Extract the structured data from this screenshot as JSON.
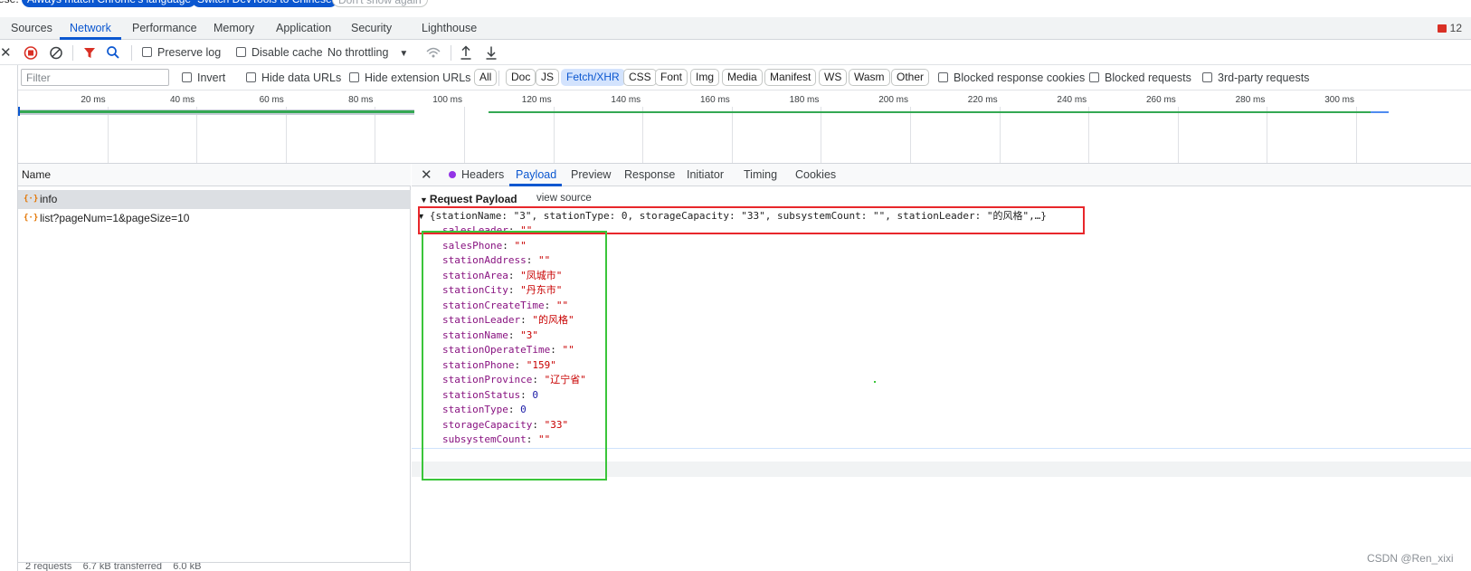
{
  "banner": {
    "prefix": "ese:",
    "buttons": [
      "Always match Chrome's language",
      "Switch DevTools to Chinese",
      "Don't show again"
    ]
  },
  "main_tabs": [
    "Sources",
    "Network",
    "Performance",
    "Memory",
    "Application",
    "Security",
    "Lighthouse"
  ],
  "active_main_tab": "Network",
  "issues_count": "12",
  "toolbar": {
    "preserve_log": "Preserve log",
    "disable_cache": "Disable cache",
    "throttling": "No throttling"
  },
  "filter": {
    "placeholder": "Filter",
    "invert": "Invert",
    "hide_data_urls": "Hide data URLs",
    "hide_extension_urls": "Hide extension URLs",
    "types": [
      "All",
      "Doc",
      "JS",
      "Fetch/XHR",
      "CSS",
      "Font",
      "Img",
      "Media",
      "Manifest",
      "WS",
      "Wasm",
      "Other"
    ],
    "selected_type": "Fetch/XHR",
    "blocked_response_cookies": "Blocked response cookies",
    "blocked_requests": "Blocked requests",
    "third_party": "3rd-party requests"
  },
  "timeline": {
    "ticks": [
      "20 ms",
      "40 ms",
      "60 ms",
      "80 ms",
      "100 ms",
      "120 ms",
      "140 ms",
      "160 ms",
      "180 ms",
      "200 ms",
      "220 ms",
      "240 ms",
      "260 ms",
      "280 ms",
      "300 ms"
    ]
  },
  "requests": {
    "header": "Name",
    "items": [
      {
        "icon": "{·}",
        "name": "info"
      },
      {
        "icon": "{·}",
        "name": "list?pageNum=1&pageSize=10"
      }
    ],
    "status_text": "2 requests    6.7 kB transferred    6.0 kB"
  },
  "detail": {
    "tabs": [
      "Headers",
      "Payload",
      "Preview",
      "Response",
      "Initiator",
      "Timing",
      "Cookies"
    ],
    "active_tab": "Payload",
    "payload_title": "Request Payload",
    "view_source": "view source",
    "summary": "{stationName: \"3\", stationType: 0, storageCapacity: \"33\", subsystemCount: \"\", stationLeader: \"的风格\",…}",
    "properties": [
      {
        "key": "salesLeader",
        "value": "\"\"",
        "kind": "string"
      },
      {
        "key": "salesPhone",
        "value": "\"\"",
        "kind": "string"
      },
      {
        "key": "stationAddress",
        "value": "\"\"",
        "kind": "string"
      },
      {
        "key": "stationArea",
        "value": "\"凤城市\"",
        "kind": "string"
      },
      {
        "key": "stationCity",
        "value": "\"丹东市\"",
        "kind": "string"
      },
      {
        "key": "stationCreateTime",
        "value": "\"\"",
        "kind": "string"
      },
      {
        "key": "stationLeader",
        "value": "\"的风格\"",
        "kind": "string"
      },
      {
        "key": "stationName",
        "value": "\"3\"",
        "kind": "string"
      },
      {
        "key": "stationOperateTime",
        "value": "\"\"",
        "kind": "string"
      },
      {
        "key": "stationPhone",
        "value": "\"159\"",
        "kind": "string"
      },
      {
        "key": "stationProvince",
        "value": "\"辽宁省\"",
        "kind": "string"
      },
      {
        "key": "stationStatus",
        "value": "0",
        "kind": "number"
      },
      {
        "key": "stationType",
        "value": "0",
        "kind": "number"
      },
      {
        "key": "storageCapacity",
        "value": "\"33\"",
        "kind": "string"
      },
      {
        "key": "subsystemCount",
        "value": "\"\"",
        "kind": "string"
      }
    ]
  },
  "watermark": "CSDN @Ren_xixi",
  "colors": {
    "accent": "#0b57d0",
    "record": "#d93025",
    "annotation_red": "#e8272b",
    "annotation_green": "#3ac53a",
    "string_value": "#c80000",
    "key": "#881280"
  }
}
